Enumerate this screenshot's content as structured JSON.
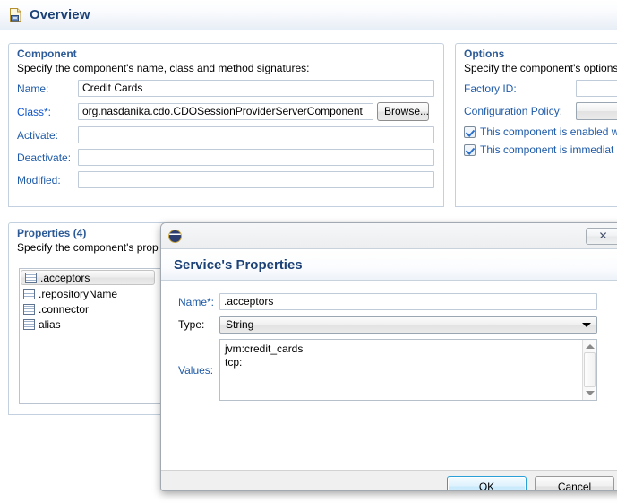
{
  "page": {
    "header": {
      "title": "Overview",
      "icon": "document-icon"
    }
  },
  "component_section": {
    "title": "Component",
    "description": "Specify the component's name, class and method signatures:",
    "fields": [
      {
        "label": "Name:",
        "value": "Credit Cards",
        "is_link": false
      },
      {
        "label": "Class*:",
        "value": "org.nasdanika.cdo.CDOSessionProviderServerComponent",
        "is_link": true
      },
      {
        "label": "Activate:",
        "value": "",
        "is_link": false
      },
      {
        "label": "Deactivate:",
        "value": "",
        "is_link": false
      },
      {
        "label": "Modified:",
        "value": "",
        "is_link": false
      }
    ],
    "browse_button": "Browse..."
  },
  "options_section": {
    "title": "Options",
    "description": "Specify the component's options",
    "factory_id_label": "Factory ID:",
    "factory_id_value": "",
    "configuration_policy_label": "Configuration Policy:",
    "configuration_policy_value": "",
    "checkboxes": [
      {
        "label": "This component is enabled w",
        "checked": true
      },
      {
        "label": "This component is immediat",
        "checked": true
      }
    ]
  },
  "properties_section": {
    "title": "Properties (4)",
    "description": "Specify the component's prop",
    "items": [
      {
        "label": ".acceptors",
        "selected": true
      },
      {
        "label": ".repositoryName",
        "selected": false
      },
      {
        "label": ".connector",
        "selected": false
      },
      {
        "label": "alias",
        "selected": false
      }
    ]
  },
  "dialog": {
    "titlebar": {
      "icon": "eclipse-icon",
      "close_label": "✕"
    },
    "banner_title": "Service's Properties",
    "name_label": "Name*:",
    "name_value": ".acceptors",
    "type_label": "Type:",
    "type_value": "String",
    "values_label": "Values:",
    "values_text": "jvm:credit_cards\ntcp:",
    "ok_button": "OK",
    "cancel_button": "Cancel"
  },
  "colors": {
    "link": "#1155cc",
    "label_blue": "#1f5ba8",
    "title_blue": "#1c4177",
    "section_title": "#2c5a96",
    "focus_blue": "#2a9fd8"
  }
}
